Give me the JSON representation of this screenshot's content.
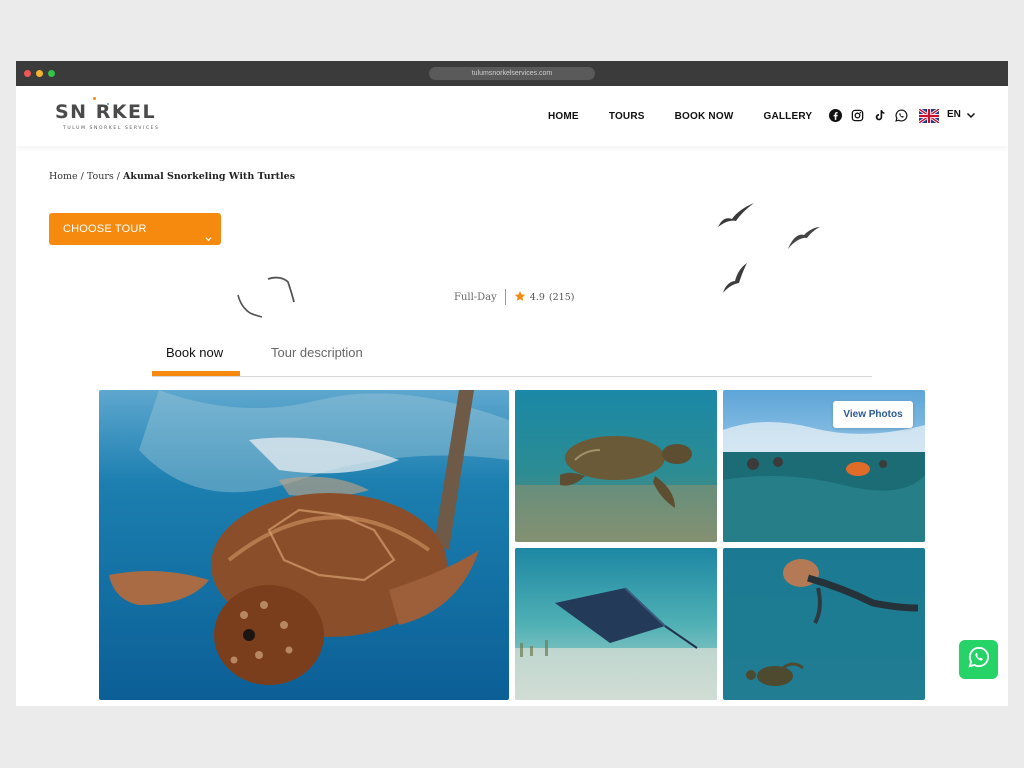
{
  "browser": {
    "url": "tulumsnorkelservices.com"
  },
  "header": {
    "logo_word": "SN RKEL",
    "logo_sub": "TULUM SNORKEL SERVICES",
    "nav": [
      "HOME",
      "TOURS",
      "BOOK NOW",
      "GALLERY"
    ],
    "social_icons": [
      "facebook-icon",
      "instagram-icon",
      "tiktok-icon",
      "whatsapp-icon"
    ],
    "language": "EN"
  },
  "breadcrumb": {
    "home": "Home",
    "tours": "Tours",
    "current": "Akumal Snorkeling With Turtles",
    "separator": "/"
  },
  "choose_tour": {
    "label": "CHOOSE TOUR"
  },
  "meta": {
    "duration": "Full-Day",
    "rating": "4.9",
    "reviews": "(215)"
  },
  "tabs": [
    {
      "label": "Book now",
      "active": true
    },
    {
      "label": "Tour description",
      "active": false
    }
  ],
  "gallery": {
    "view_photos_label": "View Photos"
  },
  "colors": {
    "accent": "#f68a0e",
    "whatsapp": "#25d366",
    "link": "#2a5a95"
  }
}
